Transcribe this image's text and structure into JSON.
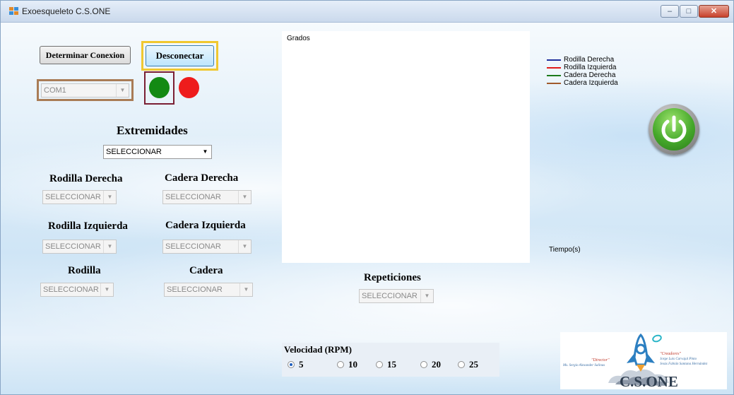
{
  "window": {
    "title": "Exoesqueleto  C.S.ONE",
    "buttons": {
      "minimize": "–",
      "maximize": "□",
      "close": "✕"
    }
  },
  "connection": {
    "determine_label": "Determinar Conexion",
    "disconnect_label": "Desconectar",
    "port_value": "COM1",
    "led_connected_color": "#138a13",
    "led_disconnected_color": "#ee1c1c"
  },
  "extremities": {
    "title": "Extremidades",
    "selected": "SELECCIONAR"
  },
  "joints": [
    {
      "label": "Rodilla Derecha",
      "selected": "SELECCIONAR"
    },
    {
      "label": "Cadera Derecha",
      "selected": "SELECCIONAR"
    },
    {
      "label": "Rodilla Izquierda",
      "selected": "SELECCIONAR"
    },
    {
      "label": "Cadera Izquierda",
      "selected": "SELECCIONAR"
    },
    {
      "label": "Rodilla",
      "selected": "SELECCIONAR"
    },
    {
      "label": "Cadera",
      "selected": "SELECCIONAR"
    }
  ],
  "repetitions": {
    "label": "Repeticiones",
    "selected": "SELECCIONAR"
  },
  "chart_data": {
    "type": "line",
    "ylabel": "Grados",
    "xlabel": "Tiempo(s)",
    "legend_position": "top-right",
    "series": [
      {
        "name": "Rodilla Derecha",
        "color": "#1f2f9c",
        "values": []
      },
      {
        "name": "Rodilla Izquierda",
        "color": "#e01b1b",
        "values": []
      },
      {
        "name": "Cadera Derecha",
        "color": "#1b7a1b",
        "values": []
      },
      {
        "name": "Cadera Izquierda",
        "color": "#a05a2c",
        "values": []
      }
    ]
  },
  "power_button": {
    "icon": "power-icon",
    "color": "#45a82a"
  },
  "speed": {
    "label": "Velocidad (RPM)",
    "options": [
      "5",
      "10",
      "15",
      "20",
      "25"
    ],
    "selected": "5"
  },
  "logo": {
    "director_title": "\"Director\"",
    "director_name": "Ms. Sergio Alexander Salinas",
    "creators_title": "\"Creadores\"",
    "creator_1": "Jorge Luis Carvajal Pinto",
    "creator_2": "Jesús Fabián Santana Hernández",
    "brand": "C.S.ONE"
  }
}
